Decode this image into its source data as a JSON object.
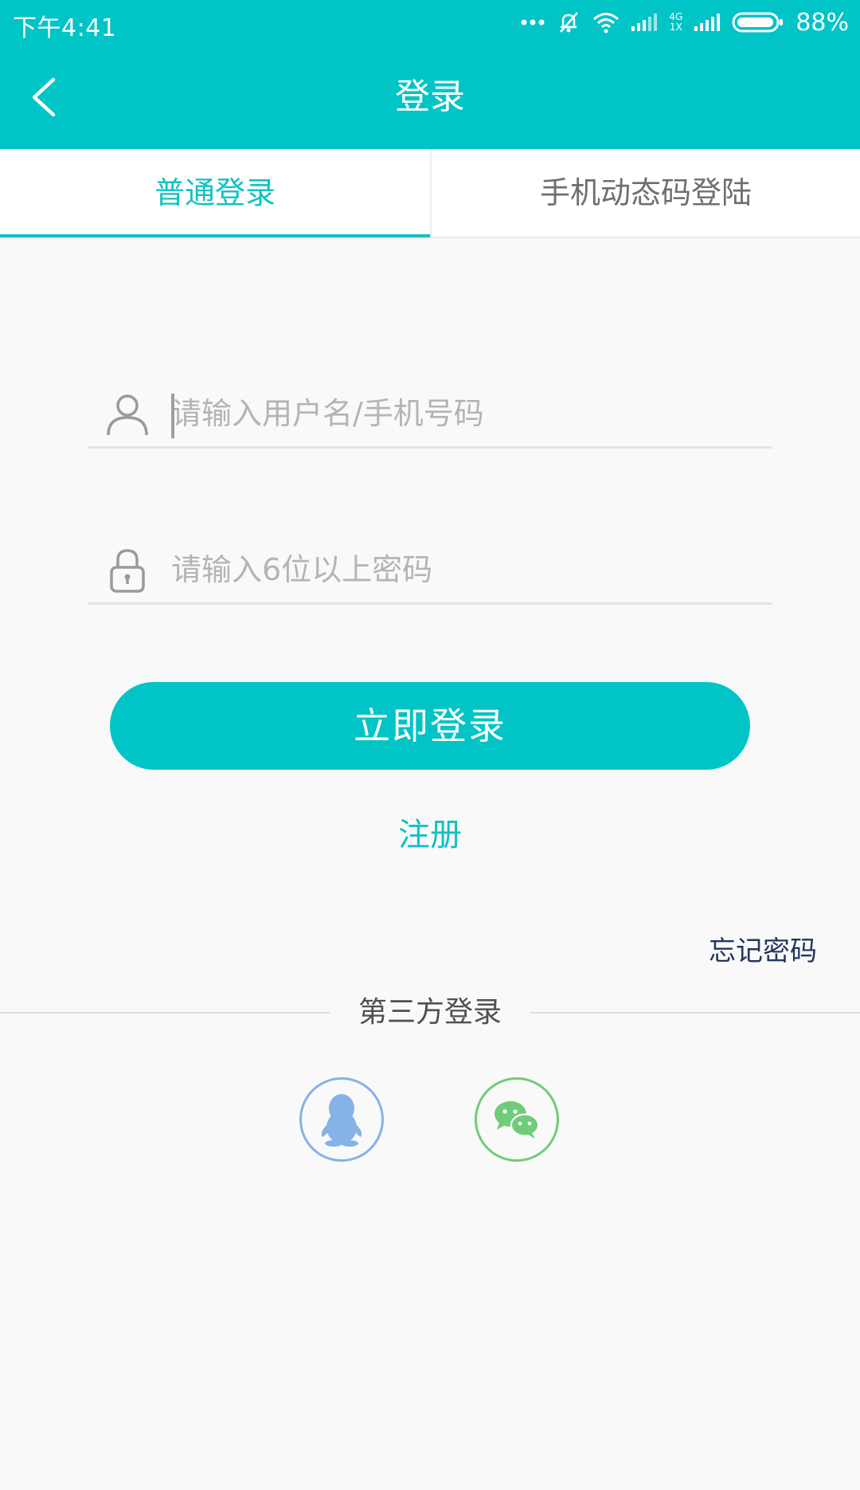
{
  "status_bar": {
    "time": "下午4:41",
    "network_top": "4G",
    "network_bottom": "1X",
    "battery": "88%"
  },
  "header": {
    "title": "登录"
  },
  "tabs": [
    {
      "label": "普通登录",
      "active": true
    },
    {
      "label": "手机动态码登陆",
      "active": false
    }
  ],
  "form": {
    "username_placeholder": "请输入用户名/手机号码",
    "password_placeholder": "请输入6位以上密码",
    "login_label": "立即登录",
    "register_label": "注册",
    "forgot_label": "忘记密码"
  },
  "third_party": {
    "title": "第三方登录",
    "providers": [
      {
        "icon": "qq-icon",
        "color": "#86b2e6"
      },
      {
        "icon": "wechat-icon",
        "color": "#70cc78"
      }
    ]
  },
  "colors": {
    "accent": "#00c4c6",
    "tab_active": "#12c1c3",
    "forgot": "#24365e"
  }
}
